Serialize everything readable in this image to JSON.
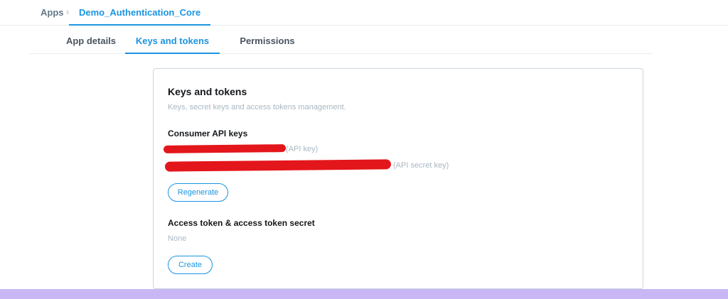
{
  "breadcrumb": {
    "root": "Apps",
    "separator": "›",
    "current": "Demo_Authentication_Core"
  },
  "tabs": [
    {
      "label": "App details",
      "active": false
    },
    {
      "label": "Keys and tokens",
      "active": true
    },
    {
      "label": "Permissions",
      "active": false
    }
  ],
  "card": {
    "title": "Keys and tokens",
    "description": "Keys, secret keys and access tokens management.",
    "consumer": {
      "title": "Consumer API keys",
      "api_key_caption": "(API key)",
      "api_secret_caption": "(API secret key)",
      "regenerate_label": "Regenerate"
    },
    "access": {
      "title": "Access token & access token secret",
      "value": "None",
      "create_label": "Create"
    }
  },
  "colors": {
    "accent": "#1b95e0",
    "redaction": "#e3161b",
    "muted_text": "#aab8c2",
    "bottom_band": "#c9b7f5"
  }
}
